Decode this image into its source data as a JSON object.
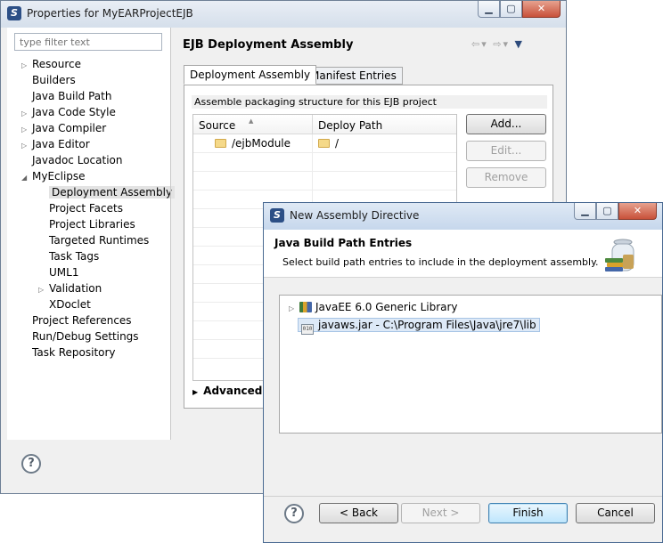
{
  "main_window": {
    "title": "Properties for MyEARProjectEJB",
    "filter_placeholder": "type filter text",
    "tree": [
      {
        "label": "Resource",
        "expandable": true
      },
      {
        "label": "Builders",
        "expandable": false
      },
      {
        "label": "Java Build Path",
        "expandable": false
      },
      {
        "label": "Java Code Style",
        "expandable": true
      },
      {
        "label": "Java Compiler",
        "expandable": true
      },
      {
        "label": "Java Editor",
        "expandable": true
      },
      {
        "label": "Javadoc Location",
        "expandable": false
      },
      {
        "label": "MyEclipse",
        "expandable": true,
        "expanded": true
      },
      {
        "label": "Deployment Assembly",
        "selected": true
      },
      {
        "label": "Project Facets"
      },
      {
        "label": "Project Libraries"
      },
      {
        "label": "Targeted Runtimes"
      },
      {
        "label": "Task Tags"
      },
      {
        "label": "UML1"
      },
      {
        "label": "Validation",
        "expandable": true
      },
      {
        "label": "XDoclet"
      },
      {
        "label": "Project References"
      },
      {
        "label": "Run/Debug Settings"
      },
      {
        "label": "Task Repository"
      }
    ],
    "page_title": "EJB Deployment Assembly",
    "tabs": [
      "Deployment Assembly",
      "Manifest Entries"
    ],
    "section_label": "Assemble packaging structure for this EJB project",
    "table": {
      "columns": [
        "Source",
        "Deploy Path"
      ],
      "rows": [
        [
          "/ejbModule",
          "/"
        ]
      ]
    },
    "buttons": {
      "add": "Add...",
      "edit": "Edit...",
      "remove": "Remove"
    },
    "advanced_label": "Advanced"
  },
  "dialog": {
    "title": "New Assembly Directive",
    "header_title": "Java Build Path Entries",
    "header_subtitle": "Select build path entries to include in the deployment assembly.",
    "entries": [
      {
        "label": "JavaEE 6.0 Generic Library",
        "icon": "library-icon"
      },
      {
        "label": "javaws.jar - C:\\Program Files\\Java\\jre7\\lib",
        "icon": "jar-icon"
      }
    ],
    "buttons": {
      "back": "< Back",
      "next": "Next >",
      "finish": "Finish",
      "cancel": "Cancel"
    }
  }
}
